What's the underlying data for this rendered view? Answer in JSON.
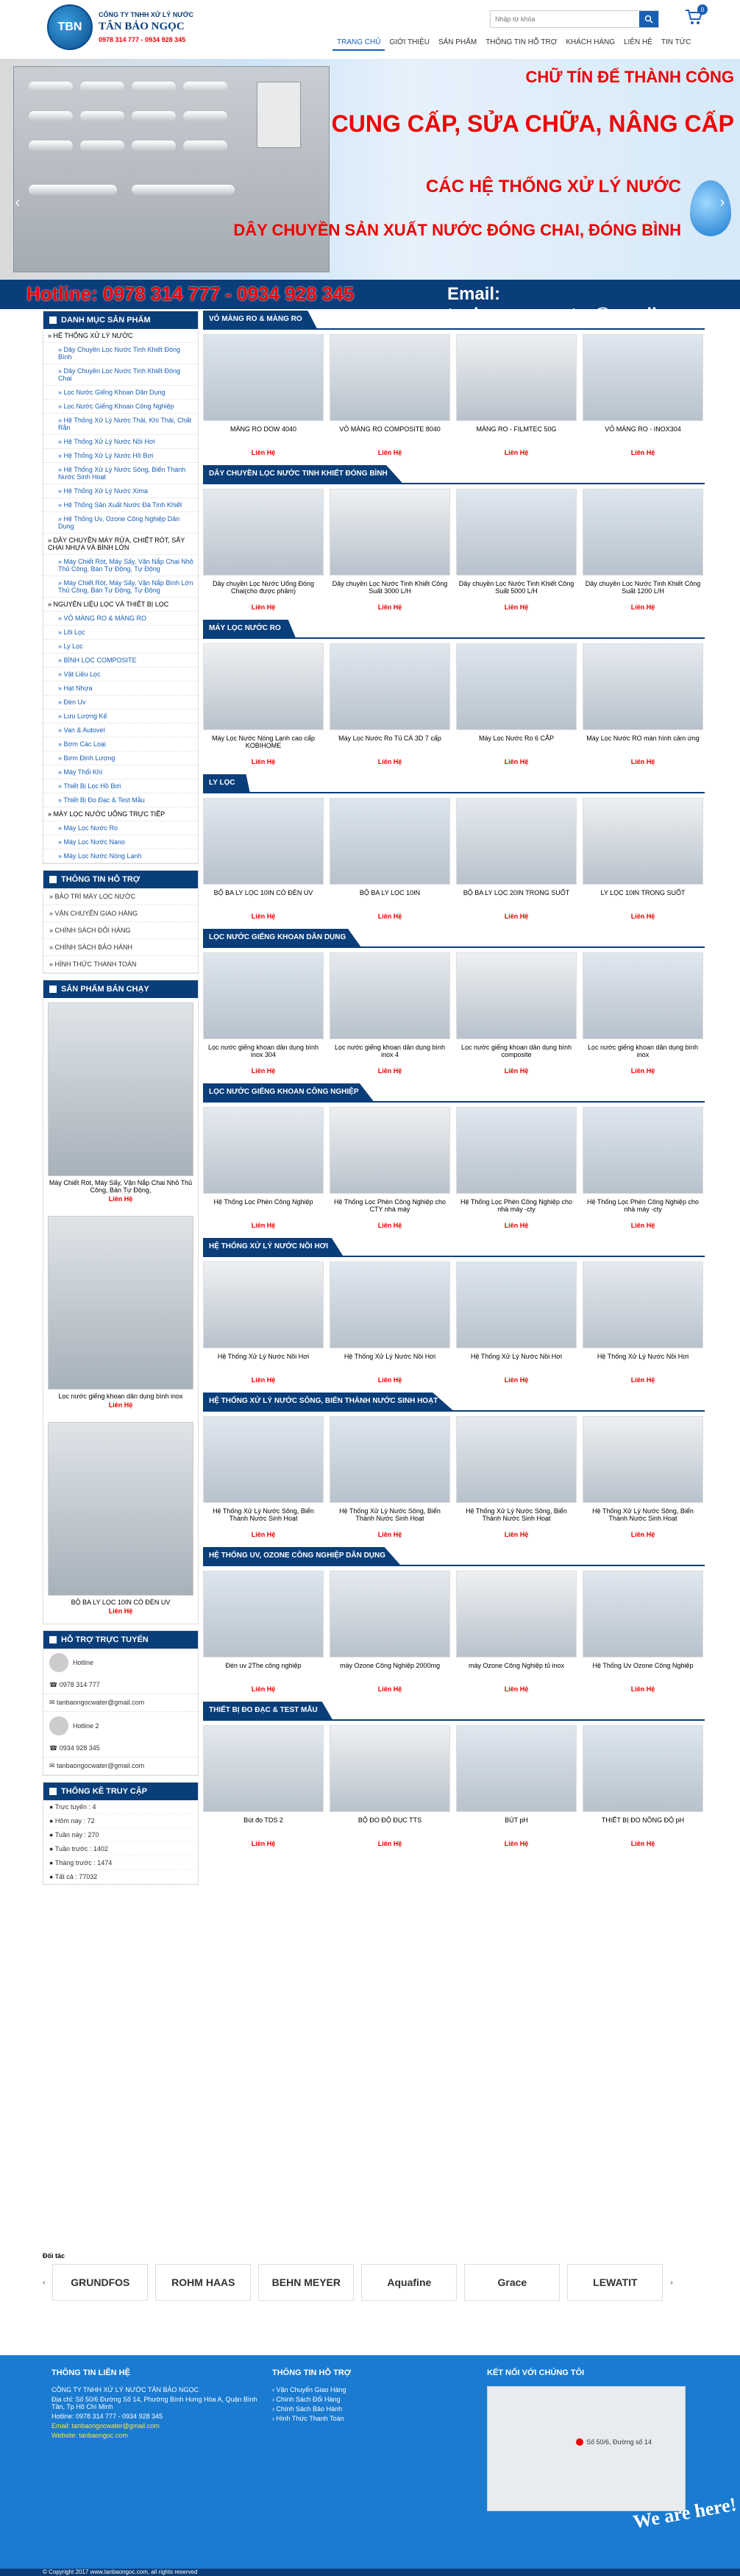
{
  "header": {
    "logo_badge": "TBN",
    "company_line1": "CÔNG TY TNHH XỬ LÝ NƯỚC",
    "company_line2": "TÂN BẢO NGỌC",
    "phones": "0978 314 777 - 0934 928 345",
    "search_placeholder": "Nhập từ khóa",
    "cart_count": "0",
    "nav": [
      "TRANG CHỦ",
      "GIỚI THIỆU",
      "SẢN PHẨM",
      "THÔNG TIN HỖ TRỢ",
      "KHÁCH HÀNG",
      "LIÊN HỆ",
      "TIN TỨC"
    ]
  },
  "banner": {
    "line1": "CHỮ TÍN ĐỂ THÀNH CÔNG",
    "line2": "CUNG CẤP, SỬA CHỮA, NÂNG CẤP",
    "line3": "CÁC HỆ THỐNG XỬ LÝ NƯỚC",
    "line4": "DÂY CHUYỀN SẢN XUẤT NƯỚC ĐÓNG CHAI, ĐÓNG BÌNH",
    "hotline": "Hotline: 0978 314 777 - 0934 928 345",
    "email": "Email: tanbaongocwater@gmail.com"
  },
  "sidebar": {
    "cat_title": "DANH MỤC SẢN PHẨM",
    "categories": [
      {
        "t": "HỆ THỐNG XỬ LÝ NƯỚC",
        "lvl": 0
      },
      {
        "t": "Dây Chuyền Lọc Nước Tinh Khiết Đóng Bình",
        "lvl": 1
      },
      {
        "t": "Dây Chuyền Lọc Nước Tinh Khiết Đóng Chai",
        "lvl": 1
      },
      {
        "t": "Lọc Nước Giếng Khoan Dân Dụng",
        "lvl": 1
      },
      {
        "t": "Lọc Nước Giếng Khoan Công Nghiệp",
        "lvl": 1
      },
      {
        "t": "Hệ Thống Xử Lý Nước Thải, Khí Thải, Chất Rắn",
        "lvl": 1
      },
      {
        "t": "Hệ Thống Xử Lý Nước Nồi Hơi",
        "lvl": 1
      },
      {
        "t": "Hệ Thống Xử Lý Nước Hồ Bơi",
        "lvl": 1
      },
      {
        "t": "Hệ Thống Xử Lý Nước Sông, Biển Thành Nước Sinh Hoạt",
        "lvl": 1
      },
      {
        "t": "Hệ Thống Xử Lý Nước Xima",
        "lvl": 1
      },
      {
        "t": "Hệ Thống Sản Xuất Nước Đá Tinh Khiết",
        "lvl": 1
      },
      {
        "t": "Hệ Thống Uv, Ozone Công Nghiệp Dân Dụng",
        "lvl": 1
      },
      {
        "t": "DÂY CHUYỀN MÁY RỬA, CHIẾT RÓT, SẤY CHAI NHỰA VÀ BÌNH LỚN",
        "lvl": 0
      },
      {
        "t": "Máy Chiết Rót, Máy Sấy, Vặn Nắp Chai Nhỏ Thủ Công, Bán Tự Động, Tự Động",
        "lvl": 1
      },
      {
        "t": "Máy Chiết Rót, Máy Sấy, Vặn Nắp Bình Lớn Thủ Công, Bán Tự Động, Tự Động",
        "lvl": 1
      },
      {
        "t": "NGUYÊN LIỆU LỌC VÀ THIẾT BỊ LỌC",
        "lvl": 0
      },
      {
        "t": "VỎ MÀNG RO & MÀNG RO",
        "lvl": 1
      },
      {
        "t": "Lõi Lọc",
        "lvl": 1
      },
      {
        "t": "Ly Lọc",
        "lvl": 1
      },
      {
        "t": "BÌNH LỌC COMPOSITE",
        "lvl": 1
      },
      {
        "t": "Vật Liệu Lọc",
        "lvl": 1
      },
      {
        "t": "Hạt Nhựa",
        "lvl": 1
      },
      {
        "t": "Đèn Uv",
        "lvl": 1
      },
      {
        "t": "Lưu Lượng Kế",
        "lvl": 1
      },
      {
        "t": "Van & Autovel",
        "lvl": 1
      },
      {
        "t": "Bơm Các Loại",
        "lvl": 1
      },
      {
        "t": "Bơm Định Lượng",
        "lvl": 1
      },
      {
        "t": "Máy Thổi Khí",
        "lvl": 1
      },
      {
        "t": "Thiết Bị Lọc Hồ Bơi",
        "lvl": 1
      },
      {
        "t": "Thiết Bị Đo Đạc & Test Mẫu",
        "lvl": 1
      },
      {
        "t": "MÁY LỌC NƯỚC UỐNG TRỰC TIẾP",
        "lvl": 0
      },
      {
        "t": "Máy Lọc Nước Ro",
        "lvl": 1
      },
      {
        "t": "Máy Lọc Nước Nano",
        "lvl": 1
      },
      {
        "t": "Máy Lọc Nước Nóng Lạnh",
        "lvl": 1
      }
    ],
    "support_title": "THÔNG TIN HỖ TRỢ",
    "support": [
      "BẢO TRÌ MÁY LỌC NƯỚC",
      "VẬN CHUYỂN GIAO HÀNG",
      "CHÍNH SÁCH ĐỔI HÀNG",
      "CHÍNH SÁCH BẢO HÀNH",
      "HÌNH THỨC THANH TOÁN"
    ],
    "best_title": "SẢN PHẨM BÁN CHẠY",
    "best": [
      {
        "n": "Máy Chiết Rót, Máy Sấy, Vặn Nắp Chai Nhỏ Thủ Công, Bán Tự Động,",
        "p": "Liên Hệ"
      },
      {
        "n": "Lọc nước giếng khoan dân dụng bình inox",
        "p": "Liên Hệ"
      },
      {
        "n": "BỘ BA LY LỌC 10IN CÓ ĐÈN UV",
        "p": "Liên Hệ"
      }
    ],
    "hotline_title": "HỖ TRỢ TRỰC TUYẾN",
    "hotline": [
      {
        "n": "Hotline",
        "ph": "0978 314 777",
        "em": "tanbaongocwater@gmail.com"
      },
      {
        "n": "Hotline 2",
        "ph": "0934 928 345",
        "em": "tanbaongocwater@gmail.com"
      }
    ],
    "stats_title": "THỐNG KÊ TRUY CẬP",
    "stats": [
      "Trực tuyến : 4",
      "Hôm nay : 72",
      "Tuần này : 270",
      "Tuần trước : 1402",
      "Tháng trước : 1474",
      "Tất cả : 77032"
    ]
  },
  "sections": [
    {
      "t": "VỎ MÀNG RO & MÀNG RO",
      "items": [
        [
          "MÀNG RO DOW 4040",
          "Liên Hệ"
        ],
        [
          "VỎ MÀNG RO COMPOSITE 8040",
          "Liên Hệ"
        ],
        [
          "MÀNG RO - FILMTEC 50G",
          "Liên Hệ"
        ],
        [
          "VỎ MÀNG RO - INOX304",
          "Liên Hệ"
        ]
      ]
    },
    {
      "t": "DÂY CHUYỀN LỌC NƯỚC TINH KHIẾT ĐÓNG BÌNH",
      "items": [
        [
          "Dây chuyền Lọc Nước Uống Đóng Chai(cho được phâm)",
          "Liên Hệ"
        ],
        [
          "Dây chuyền Lọc Nước Tinh Khiết Công Suất 3000 L/H",
          "Liên Hệ"
        ],
        [
          "Dây chuyền Lọc Nước Tinh Khiết Công Suất 5000 L/H",
          "Liên Hệ"
        ],
        [
          "Dây chuyền Lọc Nước Tinh Khiết Công Suất 1200 L/H",
          "Liên Hệ"
        ]
      ]
    },
    {
      "t": "MÁY LỌC NƯỚC RO",
      "items": [
        [
          "Máy Lọc Nước Nóng Lạnh cao cấp KOBIHOME",
          "Liên Hệ"
        ],
        [
          "Máy Lọc Nước Ro Tủ CÁ 3D 7 cấp",
          "Liên Hệ"
        ],
        [
          "Máy Lọc Nước Ro 6 CẤP",
          "Liên Hệ"
        ],
        [
          "Máy Lọc Nước RO màn hình cảm ứng",
          "Liên Hệ"
        ]
      ]
    },
    {
      "t": "LY LỌC",
      "items": [
        [
          "BỘ BA LY LỌC 10IN CÓ ĐÈN UV",
          "Liên Hệ"
        ],
        [
          "BỘ BA LY LỌC 10IN",
          "Liên Hệ"
        ],
        [
          "BỘ BA LY LỌC 20IN TRONG SUỐT",
          "Liên Hệ"
        ],
        [
          "LY LỌC 10IN TRONG SUỐT",
          "Liên Hệ"
        ]
      ]
    },
    {
      "t": "LỌC NƯỚC GIẾNG KHOAN DÂN DỤNG",
      "items": [
        [
          "Lọc nước giếng khoan dân dụng bình inox 304",
          "Liên Hệ"
        ],
        [
          "Lọc nước giếng khoan dân dụng bình inox 4",
          "Liên Hệ"
        ],
        [
          "Lọc nước giếng khoan dân dụng bình composite",
          "Liên Hệ"
        ],
        [
          "Lọc nước giếng khoan dân dụng bình inox",
          "Liên Hệ"
        ]
      ]
    },
    {
      "t": "LỌC NƯỚC GIẾNG KHOAN CÔNG NGHIỆP",
      "items": [
        [
          "Hệ Thống Lọc Phèn Công Nghiệp",
          "Liên Hệ"
        ],
        [
          "Hệ Thống Lọc Phèn Công Nghiệp cho CTY nhà máy",
          "Liên Hệ"
        ],
        [
          "Hệ Thống Lọc Phèn Công Nghiệp cho nhà máy -cty",
          "Liên Hệ"
        ],
        [
          "Hệ Thống Lọc Phèn Công Nghiệp cho nhà máy -cty",
          "Liên Hệ"
        ]
      ]
    },
    {
      "t": "HỆ THỐNG XỬ LÝ NƯỚC NỒI HƠI",
      "items": [
        [
          "Hệ Thống Xử Lý Nước Nồi Hơi",
          "Liên Hệ"
        ],
        [
          "Hệ Thống Xử Lý Nước Nồi Hơi",
          "Liên Hệ"
        ],
        [
          "Hệ Thống Xử Lý Nước Nồi Hơi",
          "Liên Hệ"
        ],
        [
          "Hệ Thống Xử Lý Nước Nồi Hơi",
          "Liên Hệ"
        ]
      ]
    },
    {
      "t": "HỆ THỐNG XỬ LÝ NƯỚC SÔNG, BIỂN THÀNH NƯỚC SINH HOẠT",
      "items": [
        [
          "Hệ Thống Xử Lý Nước Sông, Biển Thành Nước Sinh Hoạt",
          "Liên Hệ"
        ],
        [
          "Hệ Thống Xử Lý Nước Sông, Biển Thành Nước Sinh Hoạt",
          "Liên Hệ"
        ],
        [
          "Hệ Thống Xử Lý Nước Sông, Biển Thành Nước Sinh Hoạt",
          "Liên Hệ"
        ],
        [
          "Hệ Thống Xử Lý Nước Sông, Biển Thành Nước Sinh Hoạt",
          "Liên Hệ"
        ]
      ]
    },
    {
      "t": "HỆ THỐNG UV, OZONE CÔNG NGHIỆP DÂN DỤNG",
      "items": [
        [
          "Đèn uv 2The công nghiệp",
          "Liên Hệ"
        ],
        [
          "máy Ozone Công Nghiệp 2000mg",
          "Liên Hệ"
        ],
        [
          "máy Ozone Công Nghiệp tủ inox",
          "Liên Hệ"
        ],
        [
          "Hệ Thống Uv Ozone Công Nghiệp",
          "Liên Hệ"
        ]
      ]
    },
    {
      "t": "THIẾT BỊ ĐO ĐẠC & TEST MẪU",
      "items": [
        [
          "Bút đo TDS 2",
          "Liên Hệ"
        ],
        [
          "BỘ ĐO ĐỘ ĐỤC TTS",
          "Liên Hệ"
        ],
        [
          "BÚT pH",
          "Liên Hệ"
        ],
        [
          "THIẾT BỊ ĐO NỒNG ĐỘ pH",
          "Liên Hệ"
        ]
      ]
    }
  ],
  "partners": {
    "title": "Đối tác",
    "logos": [
      "GRUNDFOS",
      "ROHM HAAS",
      "BEHN MEYER",
      "Aquafine",
      "Grace",
      "LEWATIT"
    ]
  },
  "footer": {
    "contact_title": "THÔNG TIN LIÊN HỆ",
    "contact": [
      "CÔNG TY TNHH XỬ LÝ NƯỚC TÂN BẢO NGỌC",
      "Địa chỉ: Số 50/6 Đường Số 14, Phường Bình Hưng Hòa A, Quận Bình Tân, Tp Hồ Chí Minh",
      "Hotline: 0978 314 777 - 0934 928 345",
      "Email: tanbaongocwater@gmail.com",
      "Website: tanbaongoc.com"
    ],
    "support_title": "THÔNG TIN HỖ TRỢ",
    "support": [
      "Vận Chuyển Giao Hàng",
      "Chính Sách Đổi Hàng",
      "Chính Sách Bảo Hành",
      "Hình Thức Thanh Toán"
    ],
    "map_title": "KẾT NỐI VỚI CHÚNG TÔI",
    "map_label": "Số 50/6, Đường số 14",
    "here": "We are here!",
    "copyright": "© Copyright 2017 www.tanbaongoc.com, all rights reserved"
  }
}
